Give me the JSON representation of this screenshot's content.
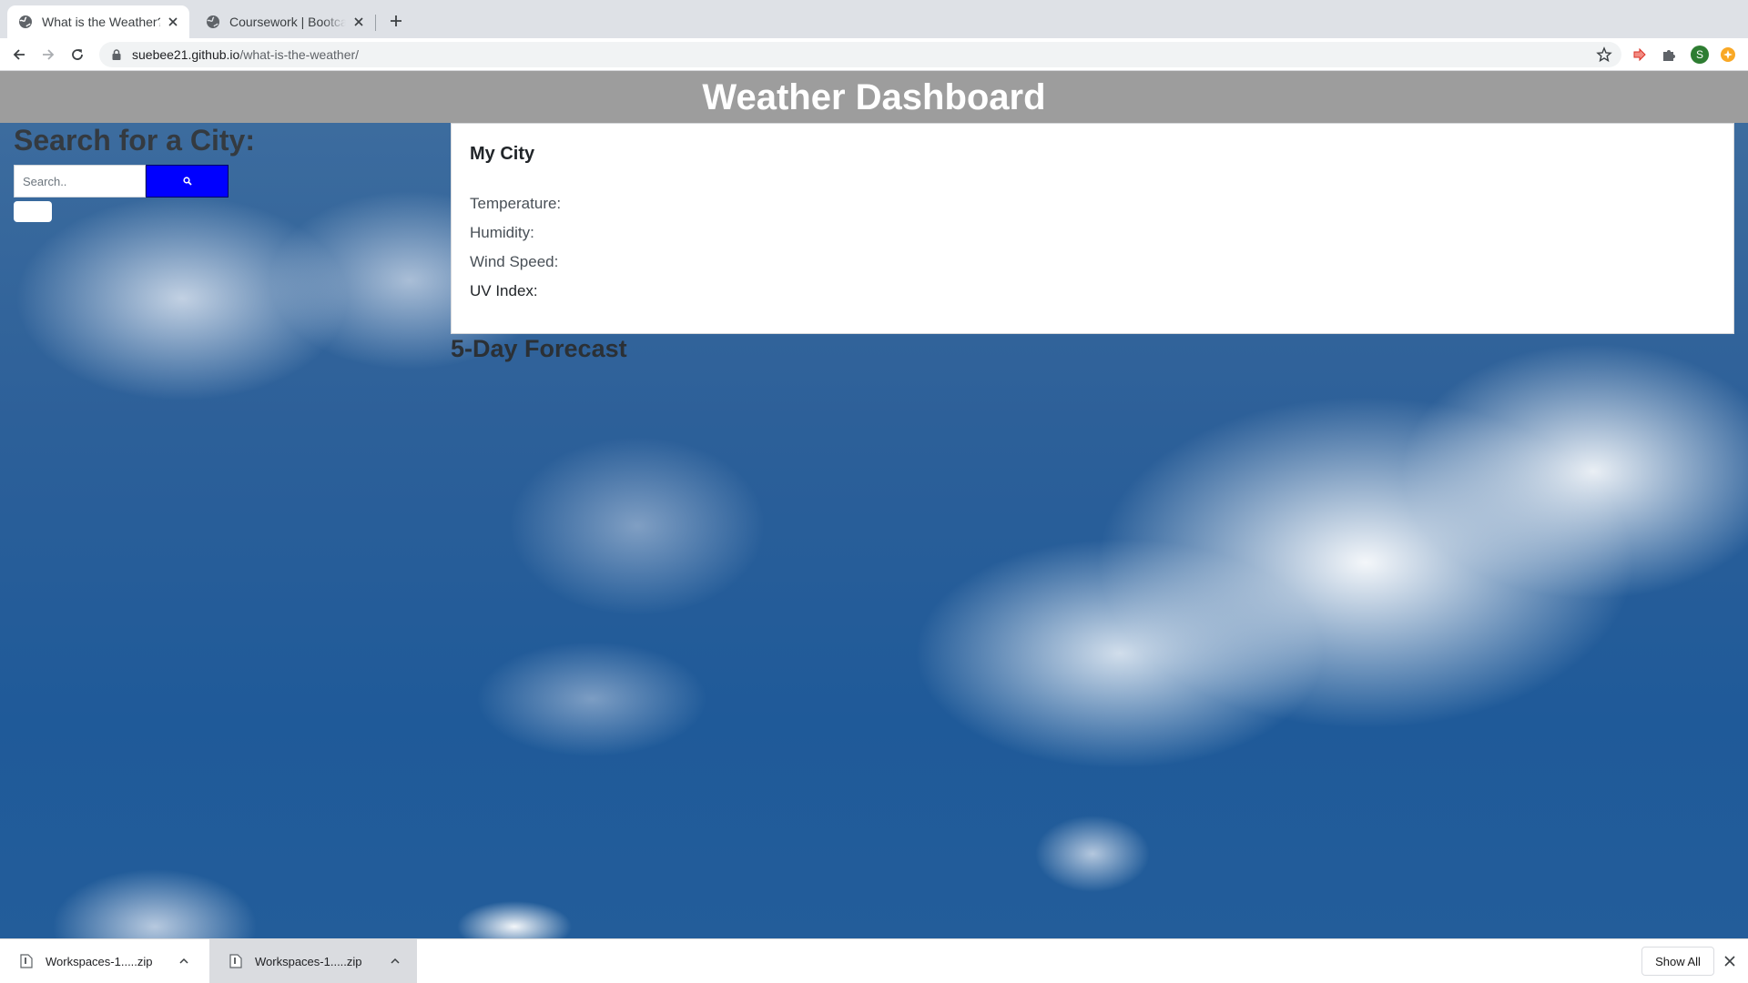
{
  "browser": {
    "tabs": [
      {
        "title": "What is the Weather?",
        "active": true
      },
      {
        "title": "Coursework | Bootcamp Spot",
        "active": false
      }
    ],
    "url": {
      "host": "suebee21.github.io",
      "path": "/what-is-the-weather/"
    },
    "profile_initial": "S"
  },
  "page": {
    "header_title": "Weather Dashboard",
    "search": {
      "heading": "Search for a City:",
      "placeholder": "Search.."
    },
    "current": {
      "city": "My City",
      "temperature_label": "Temperature:",
      "humidity_label": "Humidity:",
      "wind_label": "Wind Speed:",
      "uv_label": "UV Index:"
    },
    "forecast_heading": "5-Day Forecast"
  },
  "downloads": {
    "items": [
      {
        "name": "Workspaces-1.....zip"
      },
      {
        "name": "Workspaces-1.....zip"
      }
    ],
    "show_all_label": "Show All"
  },
  "colors": {
    "header_bg": "#9d9d9d",
    "search_button": "#0000ff",
    "sky": "#2d6099"
  }
}
